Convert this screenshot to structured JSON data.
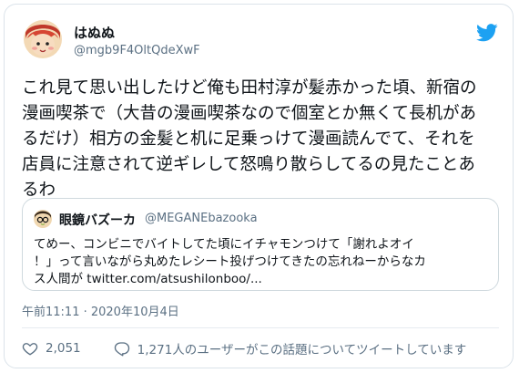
{
  "tweet": {
    "author_name": "はぬぬ",
    "author_handle": "@mgb9F4OltQdeXwF",
    "body_lines": [
      "これ見て思い出したけど俺も田村淳が髪赤かった頃、新宿の",
      "漫画喫茶で（大昔の漫画喫茶なので個室とか無くて長机があ",
      "るだけ）相方の金髪と机に足乗っけて漫画読んでて、それを",
      "店員に注意されて逆ギレして怒鳴り散らしてるの見たことあ",
      "るわ"
    ],
    "timestamp": "午前11:11 · 2020年10月4日"
  },
  "quoted": {
    "author_name": "眼鏡バズーカ",
    "author_handle": "@MEGANEbazooka",
    "text_lines": [
      "てめー、コンビニでバイトしてた頃にイチャモンつけて「謝れよオイ",
      "！」って言いながら丸めたレシート投げつけてきたの忘れねーからなカ",
      "ス人間が twitter.com/atsushilonboo/..."
    ]
  },
  "actions": {
    "like_count": "2,051",
    "reply_text": "1,271人のユーザーがこの話題についてツイートしています"
  },
  "icons": [
    "twitter-bird-icon",
    "heart-icon",
    "reply-icon"
  ],
  "colors": {
    "twitter_blue": "#1da1f2",
    "secondary_text": "#5b7083",
    "border": "#cfd9de"
  }
}
